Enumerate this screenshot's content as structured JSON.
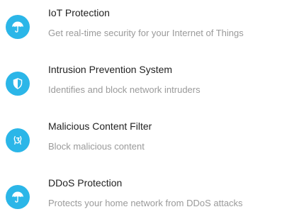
{
  "accent_color": "#2bb6e8",
  "features": [
    {
      "icon": "umbrella-icon",
      "title": "IoT Protection",
      "description": "Get real-time security for your Internet of Things"
    },
    {
      "icon": "shield-icon",
      "title": "Intrusion Prevention System",
      "description": "Identifies and block network intruders"
    },
    {
      "icon": "filter-icon",
      "title": "Malicious Content Filter",
      "description": "Block malicious content"
    },
    {
      "icon": "umbrella-icon",
      "title": "DDoS Protection",
      "description": "Protects your home network from DDoS attacks"
    }
  ]
}
